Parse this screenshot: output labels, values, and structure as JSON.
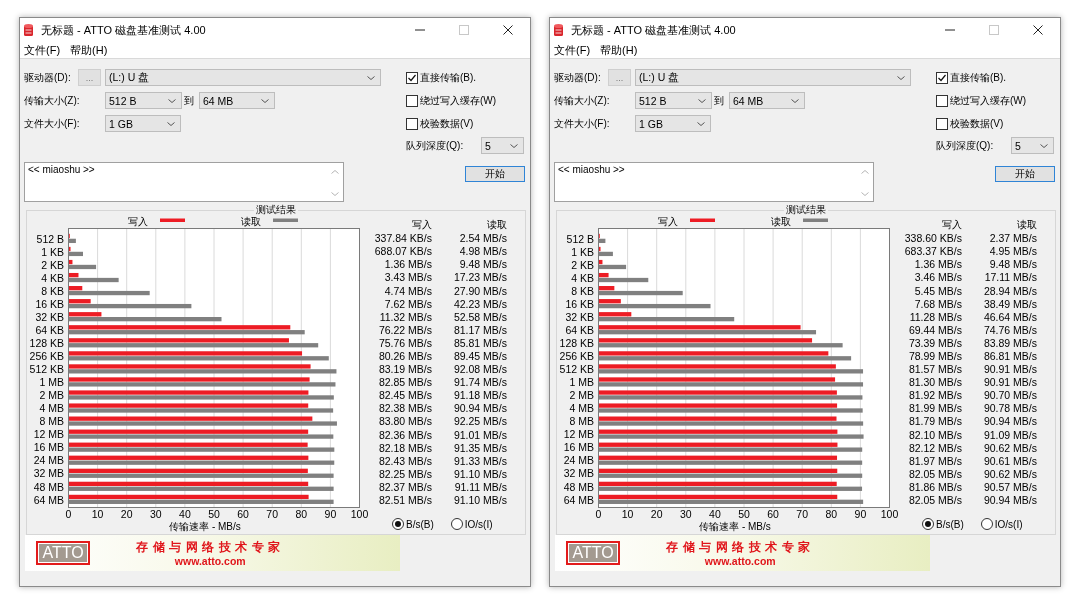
{
  "windows": [
    {
      "title": "无标题 - ATTO 磁盘基准测试 4.00",
      "menu": [
        "文件(F)",
        "帮助(H)"
      ],
      "drive": {
        "label": "驱动器(D):",
        "browse_button": "...",
        "value": "(L:) U 盘"
      },
      "transfer_size": {
        "label": "传输大小(Z):",
        "from": "512 B",
        "separator": "到",
        "to": "64 MB"
      },
      "file_size": {
        "label": "文件大小(F):",
        "value": "1 GB"
      },
      "options": [
        {
          "label": "直接传输(B).",
          "checked": true
        },
        {
          "label": "绕过写入缓存(W)",
          "checked": false
        },
        {
          "label": "校验数据(V)",
          "checked": false
        }
      ],
      "queue_depth": {
        "label": "队列深度(Q):",
        "value": "5"
      },
      "description": "<< miaoshu >>",
      "start_button": "开始",
      "results": {
        "title": "测试结果",
        "chart_data": [
          {
            "type": "bar",
            "orientation": "horizontal",
            "legend": "top",
            "xlabel": "传输速率 - MB/s",
            "xlim": [
              0,
              100
            ],
            "xticks": [
              0,
              10,
              20,
              30,
              40,
              50,
              60,
              70,
              80,
              90,
              100
            ],
            "grid": true,
            "categories": [
              "512 B",
              "1 KB",
              "2 KB",
              "4 KB",
              "8 KB",
              "16 KB",
              "32 KB",
              "64 KB",
              "128 KB",
              "256 KB",
              "512 KB",
              "1 MB",
              "2 MB",
              "4 MB",
              "8 MB",
              "12 MB",
              "16 MB",
              "24 MB",
              "32 MB",
              "48 MB",
              "64 MB"
            ],
            "series": [
              {
                "name": "写入",
                "color": "#ed1c24",
                "values": [
                  0.3,
                  0.7,
                  1.36,
                  3.43,
                  4.74,
                  7.62,
                  11.32,
                  76.22,
                  75.76,
                  80.26,
                  83.19,
                  82.85,
                  82.45,
                  82.38,
                  83.8,
                  82.36,
                  82.18,
                  82.43,
                  82.25,
                  82.37,
                  82.51
                ]
              },
              {
                "name": "读取",
                "color": "#808080",
                "values": [
                  2.54,
                  4.98,
                  9.48,
                  17.23,
                  27.9,
                  42.23,
                  52.58,
                  81.17,
                  85.81,
                  89.45,
                  92.08,
                  91.74,
                  91.18,
                  90.94,
                  92.25,
                  91.01,
                  91.35,
                  91.33,
                  91.1,
                  91.11,
                  91.1
                ]
              }
            ]
          }
        ],
        "table": {
          "columns": [
            "写入",
            "读取"
          ],
          "rows": [
            [
              "337.84 KB/s",
              "2.54 MB/s"
            ],
            [
              "688.07 KB/s",
              "4.98 MB/s"
            ],
            [
              "1.36 MB/s",
              "9.48 MB/s"
            ],
            [
              "3.43 MB/s",
              "17.23 MB/s"
            ],
            [
              "4.74 MB/s",
              "27.90 MB/s"
            ],
            [
              "7.62 MB/s",
              "42.23 MB/s"
            ],
            [
              "11.32 MB/s",
              "52.58 MB/s"
            ],
            [
              "76.22 MB/s",
              "81.17 MB/s"
            ],
            [
              "75.76 MB/s",
              "85.81 MB/s"
            ],
            [
              "80.26 MB/s",
              "89.45 MB/s"
            ],
            [
              "83.19 MB/s",
              "92.08 MB/s"
            ],
            [
              "82.85 MB/s",
              "91.74 MB/s"
            ],
            [
              "82.45 MB/s",
              "91.18 MB/s"
            ],
            [
              "82.38 MB/s",
              "90.94 MB/s"
            ],
            [
              "83.80 MB/s",
              "92.25 MB/s"
            ],
            [
              "82.36 MB/s",
              "91.01 MB/s"
            ],
            [
              "82.18 MB/s",
              "91.35 MB/s"
            ],
            [
              "82.43 MB/s",
              "91.33 MB/s"
            ],
            [
              "82.25 MB/s",
              "91.10 MB/s"
            ],
            [
              "82.37 MB/s",
              "91.11 MB/s"
            ],
            [
              "82.51 MB/s",
              "91.10 MB/s"
            ]
          ]
        },
        "units": [
          {
            "label": "B/s(B)",
            "selected": true
          },
          {
            "label": "IO/s(I)",
            "selected": false
          }
        ]
      },
      "banner": {
        "logo": "ATTO",
        "slogan": "存储与网络技术专家",
        "url": "www.atto.com"
      }
    },
    {
      "title": "无标题 - ATTO 磁盘基准测试 4.00",
      "menu": [
        "文件(F)",
        "帮助(H)"
      ],
      "drive": {
        "label": "驱动器(D):",
        "browse_button": "...",
        "value": "(L:) U 盘"
      },
      "transfer_size": {
        "label": "传输大小(Z):",
        "from": "512 B",
        "separator": "到",
        "to": "64 MB"
      },
      "file_size": {
        "label": "文件大小(F):",
        "value": "1 GB"
      },
      "options": [
        {
          "label": "直接传输(B).",
          "checked": true
        },
        {
          "label": "绕过写入缓存(W)",
          "checked": false
        },
        {
          "label": "校验数据(V)",
          "checked": false
        }
      ],
      "queue_depth": {
        "label": "队列深度(Q):",
        "value": "5"
      },
      "description": "<< miaoshu >>",
      "start_button": "开始",
      "results": {
        "title": "测试结果",
        "chart_data": [
          {
            "type": "bar",
            "orientation": "horizontal",
            "legend": "top",
            "xlabel": "传输速率 - MB/s",
            "xlim": [
              0,
              100
            ],
            "xticks": [
              0,
              10,
              20,
              30,
              40,
              50,
              60,
              70,
              80,
              90,
              100
            ],
            "grid": true,
            "categories": [
              "512 B",
              "1 KB",
              "2 KB",
              "4 KB",
              "8 KB",
              "16 KB",
              "32 KB",
              "64 KB",
              "128 KB",
              "256 KB",
              "512 KB",
              "1 MB",
              "2 MB",
              "4 MB",
              "8 MB",
              "12 MB",
              "16 MB",
              "24 MB",
              "32 MB",
              "48 MB",
              "64 MB"
            ],
            "series": [
              {
                "name": "写入",
                "color": "#ed1c24",
                "values": [
                  0.3,
                  0.7,
                  1.36,
                  3.46,
                  5.45,
                  7.68,
                  11.28,
                  69.44,
                  73.39,
                  78.99,
                  81.57,
                  81.3,
                  81.92,
                  81.99,
                  81.79,
                  82.1,
                  82.12,
                  81.97,
                  82.05,
                  81.86,
                  82.05
                ]
              },
              {
                "name": "读取",
                "color": "#808080",
                "values": [
                  2.37,
                  4.95,
                  9.48,
                  17.11,
                  28.94,
                  38.49,
                  46.64,
                  74.76,
                  83.89,
                  86.81,
                  90.91,
                  90.91,
                  90.7,
                  90.78,
                  90.94,
                  91.09,
                  90.62,
                  90.61,
                  90.62,
                  90.57,
                  90.94
                ]
              }
            ]
          }
        ],
        "table": {
          "columns": [
            "写入",
            "读取"
          ],
          "rows": [
            [
              "338.60 KB/s",
              "2.37 MB/s"
            ],
            [
              "683.37 KB/s",
              "4.95 MB/s"
            ],
            [
              "1.36 MB/s",
              "9.48 MB/s"
            ],
            [
              "3.46 MB/s",
              "17.11 MB/s"
            ],
            [
              "5.45 MB/s",
              "28.94 MB/s"
            ],
            [
              "7.68 MB/s",
              "38.49 MB/s"
            ],
            [
              "11.28 MB/s",
              "46.64 MB/s"
            ],
            [
              "69.44 MB/s",
              "74.76 MB/s"
            ],
            [
              "73.39 MB/s",
              "83.89 MB/s"
            ],
            [
              "78.99 MB/s",
              "86.81 MB/s"
            ],
            [
              "81.57 MB/s",
              "90.91 MB/s"
            ],
            [
              "81.30 MB/s",
              "90.91 MB/s"
            ],
            [
              "81.92 MB/s",
              "90.70 MB/s"
            ],
            [
              "81.99 MB/s",
              "90.78 MB/s"
            ],
            [
              "81.79 MB/s",
              "90.94 MB/s"
            ],
            [
              "82.10 MB/s",
              "91.09 MB/s"
            ],
            [
              "82.12 MB/s",
              "90.62 MB/s"
            ],
            [
              "81.97 MB/s",
              "90.61 MB/s"
            ],
            [
              "82.05 MB/s",
              "90.62 MB/s"
            ],
            [
              "81.86 MB/s",
              "90.57 MB/s"
            ],
            [
              "82.05 MB/s",
              "90.94 MB/s"
            ]
          ]
        },
        "units": [
          {
            "label": "B/s(B)",
            "selected": true
          },
          {
            "label": "IO/s(I)",
            "selected": false
          }
        ]
      },
      "banner": {
        "logo": "ATTO",
        "slogan": "存储与网络技术专家",
        "url": "www.atto.com"
      }
    }
  ]
}
